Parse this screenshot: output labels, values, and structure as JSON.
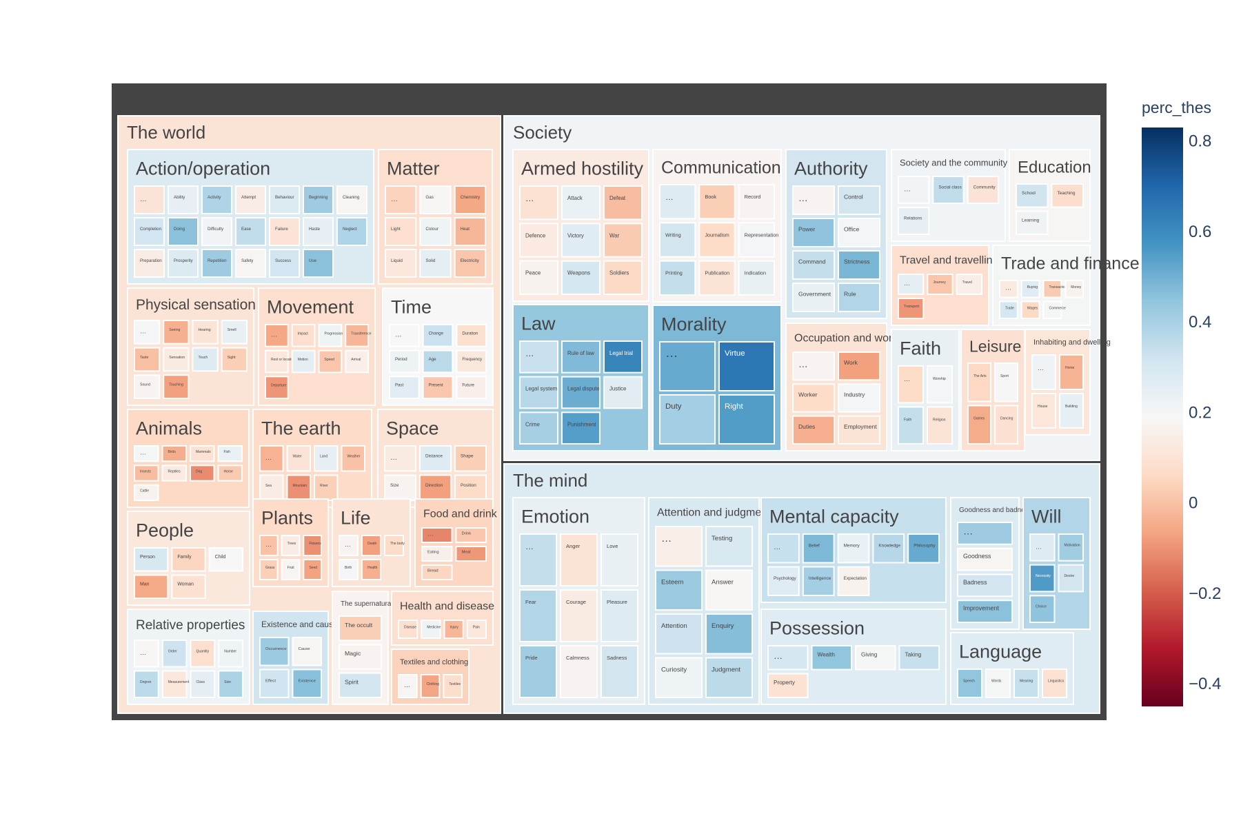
{
  "chart_data": {
    "type": "treemap",
    "colorbar": {
      "title": "perc_thes",
      "range": [
        -0.45,
        0.83
      ],
      "ticks": [
        {
          "value": 0.8,
          "label": "0.8"
        },
        {
          "value": 0.6,
          "label": "0.6"
        },
        {
          "value": 0.4,
          "label": "0.4"
        },
        {
          "value": 0.2,
          "label": "0.2"
        },
        {
          "value": 0.0,
          "label": "0"
        },
        {
          "value": -0.2,
          "label": "−0.2"
        },
        {
          "value": -0.4,
          "label": "−0.4"
        }
      ],
      "colorscale": [
        "#67001f",
        "#b2182b",
        "#d6604d",
        "#f4a582",
        "#fddbc7",
        "#f7f7f7",
        "#d1e5f0",
        "#92c5de",
        "#4393c3",
        "#2166ac",
        "#053061"
      ]
    },
    "root_color": "#444444",
    "groups": [
      {
        "name": "The world",
        "value": 0.1,
        "children": [
          {
            "name": "Action/operation",
            "value": 0.28,
            "leaves": [
              "…",
              "Ability",
              "Activity",
              "Attempt",
              "Behaviour",
              "Beginning",
              "Cleaning",
              "Completion",
              "Doing",
              "Difficulty",
              "Ease",
              "Failure",
              "Haste",
              "Neglect",
              "Preparation",
              "Prosperity",
              "Repetition",
              "Safety",
              "Success",
              "Use"
            ]
          },
          {
            "name": "Matter",
            "value": 0.08,
            "leaves": [
              "…",
              "Gas",
              "Chemistry",
              "Light",
              "Colour",
              "Heat",
              "Liquid",
              "Solid",
              "Electricity"
            ]
          },
          {
            "name": "Physical sensation",
            "value": 0.1,
            "leaves": [
              "…",
              "Seeing",
              "Hearing",
              "Smell",
              "Taste",
              "Sensation",
              "Touch",
              "Sight",
              "Sound",
              "Touching"
            ]
          },
          {
            "name": "Movement",
            "value": 0.08,
            "leaves": [
              "…",
              "Impact",
              "Progression",
              "Transference",
              "Rest or location",
              "Motion",
              "Speed",
              "Arrival",
              "Departure"
            ]
          },
          {
            "name": "Time",
            "value": 0.19,
            "leaves": [
              "…",
              "Change",
              "Duration",
              "Period",
              "Age",
              "Frequency",
              "Past",
              "Present",
              "Future"
            ]
          },
          {
            "name": "Animals",
            "value": 0.06,
            "leaves": [
              "…",
              "Birds",
              "Mammals",
              "Fish",
              "Insects",
              "Reptiles",
              "Dog",
              "Horse",
              "Cattle"
            ]
          },
          {
            "name": "The earth",
            "value": 0.07,
            "leaves": [
              "…",
              "Water",
              "Land",
              "Weather",
              "Sea",
              "Mountain",
              "River"
            ]
          },
          {
            "name": "Space",
            "value": 0.1,
            "leaves": [
              "…",
              "Distance",
              "Shape",
              "Size",
              "Direction",
              "Position"
            ]
          },
          {
            "name": "People",
            "value": 0.12,
            "leaves": [
              "Person",
              "Family",
              "Child",
              "Man",
              "Woman"
            ]
          },
          {
            "name": "Plants",
            "value": 0.07,
            "leaves": [
              "…",
              "Trees",
              "Flowers",
              "Grass",
              "Fruit",
              "Seed"
            ]
          },
          {
            "name": "Life",
            "value": 0.1,
            "leaves": [
              "…",
              "Death",
              "The body",
              "Birth",
              "Health"
            ]
          },
          {
            "name": "Food and drink",
            "value": 0.05,
            "leaves": [
              "…",
              "Drink",
              "Eating",
              "Meat",
              "Bread"
            ]
          },
          {
            "name": "Relative properties",
            "value": 0.22,
            "leaves": [
              "…",
              "Order",
              "Quantity",
              "Number",
              "Degree",
              "Measurement",
              "Class",
              "Size"
            ]
          },
          {
            "name": "Existence and causation",
            "value": 0.32,
            "leaves": [
              "Occurrence",
              "Cause",
              "Effect",
              "Existence"
            ]
          },
          {
            "name": "The supernatural",
            "value": 0.17,
            "leaves": [
              "The occult",
              "Magic",
              "Spirit"
            ]
          },
          {
            "name": "Health and disease",
            "value": 0.08,
            "leaves": [
              "Disease",
              "Medicine",
              "Injury",
              "Pain"
            ]
          },
          {
            "name": "Textiles and clothing",
            "value": 0.04,
            "leaves": [
              "…",
              "Clothing",
              "Textiles"
            ]
          }
        ]
      },
      {
        "name": "Society",
        "value": 0.21,
        "children": [
          {
            "name": "Armed hostility",
            "value": 0.13,
            "leaves": [
              "…",
              "Attack",
              "Defeat",
              "Defence",
              "Victory",
              "War",
              "Peace",
              "Weapons",
              "Soldiers"
            ]
          },
          {
            "name": "Communication",
            "value": 0.17,
            "leaves": [
              "…",
              "Book",
              "Record",
              "Writing",
              "Journalism",
              "Representation",
              "Printing",
              "Publication",
              "Indication"
            ]
          },
          {
            "name": "Authority",
            "value": 0.31,
            "leaves": [
              "…",
              "Control",
              "Power",
              "Office",
              "Command",
              "Strictness",
              "Government",
              "Rule"
            ]
          },
          {
            "name": "Society and the community",
            "value": 0.21,
            "leaves": [
              "…",
              "Social class",
              "Community",
              "Relations"
            ]
          },
          {
            "name": "Education",
            "value": 0.18,
            "leaves": [
              "School",
              "Teaching",
              "Learning"
            ]
          },
          {
            "name": "Law",
            "value": 0.44,
            "leaves": [
              "…",
              "Rule of law",
              "Legal trial",
              "Legal system",
              "Legal dispute",
              "Justice",
              "Crime",
              "Punishment"
            ]
          },
          {
            "name": "Morality",
            "value": 0.48,
            "leaves": [
              "…",
              "Virtue",
              "Duty",
              "Right"
            ]
          },
          {
            "name": "Travel and travelling",
            "value": 0.08,
            "leaves": [
              "…",
              "Journey",
              "Travel",
              "Transport"
            ]
          },
          {
            "name": "Trade and finance",
            "value": 0.2,
            "leaves": [
              "…",
              "Buying",
              "Transactions",
              "Money",
              "Trade",
              "Wages",
              "Commerce"
            ]
          },
          {
            "name": "Occupation and work",
            "value": 0.1,
            "leaves": [
              "…",
              "Work",
              "Worker",
              "Industry",
              "Duties",
              "Employment"
            ]
          },
          {
            "name": "Faith",
            "value": 0.24,
            "leaves": [
              "…",
              "Worship",
              "Faith",
              "Religion"
            ]
          },
          {
            "name": "Leisure",
            "value": 0.09,
            "leaves": [
              "The Arts",
              "Sport",
              "Games",
              "Dancing"
            ]
          },
          {
            "name": "Inhabiting and dwelling",
            "value": 0.11,
            "leaves": [
              "…",
              "Home",
              "House",
              "Building"
            ]
          }
        ]
      },
      {
        "name": "The mind",
        "value": 0.28,
        "children": [
          {
            "name": "Emotion",
            "value": 0.24,
            "leaves": [
              "…",
              "Anger",
              "Love",
              "Fear",
              "Courage",
              "Pleasure",
              "Pride",
              "Calmness",
              "Sadness"
            ]
          },
          {
            "name": "Attention and judgment",
            "value": 0.29,
            "leaves": [
              "…",
              "Testing",
              "Esteem",
              "Answer",
              "Attention",
              "Enquiry",
              "Curiosity",
              "Judgment"
            ]
          },
          {
            "name": "Mental capacity",
            "value": 0.34,
            "leaves": [
              "…",
              "Belief",
              "Memory",
              "Knowledge",
              "Philosophy",
              "Psychology",
              "Intelligence",
              "Expectation"
            ]
          },
          {
            "name": "Goodness and badness",
            "value": 0.28,
            "leaves": [
              "…",
              "Goodness",
              "Badness",
              "Improvement"
            ]
          },
          {
            "name": "Will",
            "value": 0.38,
            "leaves": [
              "…",
              "Motivation",
              "Necessity",
              "Desire",
              "Choice"
            ]
          },
          {
            "name": "Possession",
            "value": 0.27,
            "leaves": [
              "…",
              "Wealth",
              "Giving",
              "Taking",
              "Property"
            ]
          },
          {
            "name": "Language",
            "value": 0.27,
            "leaves": [
              "Speech",
              "Words",
              "Meaning",
              "Linguistics"
            ]
          }
        ]
      }
    ]
  }
}
